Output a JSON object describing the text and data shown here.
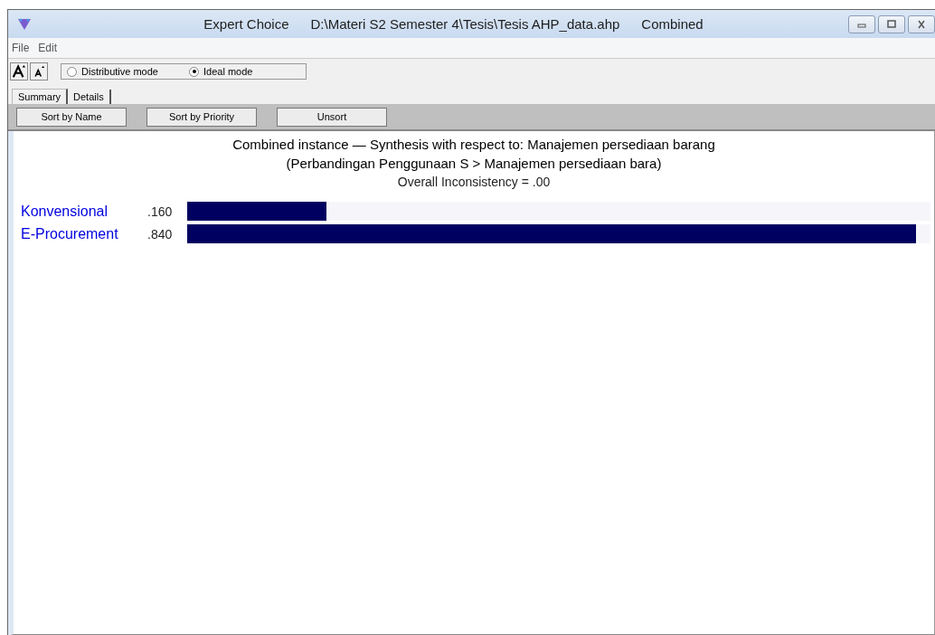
{
  "window": {
    "title_parts": [
      "Expert Choice",
      "D:\\Materi S2 Semester 4\\Tesis\\Tesis AHP_data.ahp",
      "Combined"
    ]
  },
  "menu": [
    "File",
    "Edit"
  ],
  "modes": [
    {
      "label": "Distributive mode",
      "selected": false
    },
    {
      "label": "Ideal mode",
      "selected": true
    }
  ],
  "tabs": [
    {
      "label": "Summary",
      "selected": true
    },
    {
      "label": "Details",
      "selected": false
    }
  ],
  "buttons": [
    "Sort by Name",
    "Sort by Priority",
    "Unsort"
  ],
  "synthesis": {
    "title": "Combined instance — Synthesis with respect to: Manajemen persediaan barang",
    "subtitle": "(Perbandingan Penggunaan S > Manajemen persediaan bara)",
    "inconsistency": "Overall Inconsistency = .00",
    "items": [
      {
        "name": "Konvensional",
        "value": ".160",
        "level": 0.187
      },
      {
        "name": "E-Procurement",
        "value": ".840",
        "level": 0.98
      }
    ]
  }
}
